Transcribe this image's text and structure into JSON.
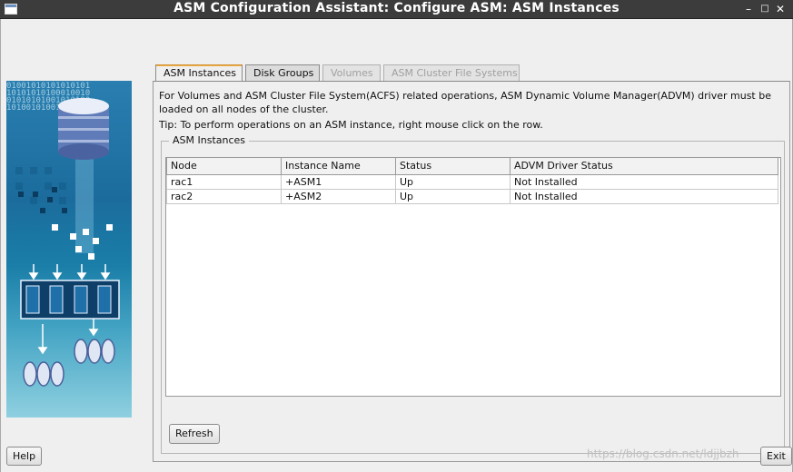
{
  "window": {
    "title": "ASM Configuration Assistant: Configure ASM: ASM Instances",
    "controls": {
      "minimize": "–",
      "maximize": "□",
      "close": "✕"
    }
  },
  "side_panel": {
    "binary_text": "01001010101010101\n10101010100010010\n01010101001010100\n10100101001010101"
  },
  "tabs": [
    {
      "label": "ASM Instances",
      "state": "active"
    },
    {
      "label": "Disk Groups",
      "state": "normal"
    },
    {
      "label": "Volumes",
      "state": "disabled"
    },
    {
      "label": "ASM Cluster File Systems",
      "state": "disabled"
    }
  ],
  "main": {
    "info_text": "For Volumes and ASM Cluster File System(ACFS) related operations, ASM Dynamic Volume Manager(ADVM) driver must be loaded on all nodes of the cluster.",
    "tip_text": "Tip: To perform operations on an ASM instance, right mouse click on the row.",
    "group_title": "ASM Instances",
    "table": {
      "columns": [
        "Node",
        "Instance Name",
        "Status",
        "ADVM Driver Status"
      ],
      "rows": [
        [
          "rac1",
          "+ASM1",
          "Up",
          "Not Installed"
        ],
        [
          "rac2",
          "+ASM2",
          "Up",
          "Not Installed"
        ]
      ]
    },
    "refresh_label": "Refresh"
  },
  "footer": {
    "help_label": "Help",
    "exit_label": "Exit",
    "watermark": "https://blog.csdn.net/ldjjbzh"
  },
  "colors": {
    "titlebar": "#3c3c3c",
    "active_tab_accent": "#f2b24c",
    "side_panel_blue": "#1b6c9d"
  }
}
